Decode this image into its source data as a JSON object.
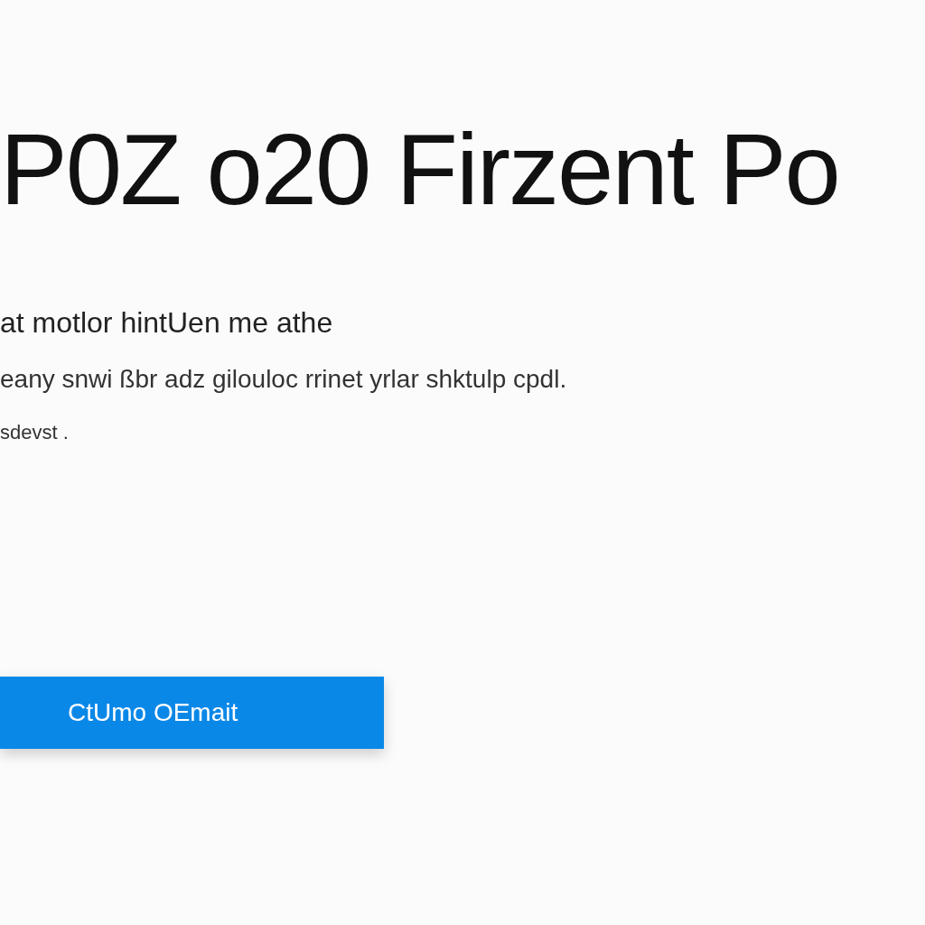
{
  "heading": "P0Z o20 Firzent Po",
  "paragraph_lines": [
    "at motlor hintUen me athe",
    "eany snwi ßbr adz gilouloc rrinet yrlar shktulp cpdl.",
    "sdevst ."
  ],
  "button": {
    "label": "CtUmo OEmait"
  }
}
